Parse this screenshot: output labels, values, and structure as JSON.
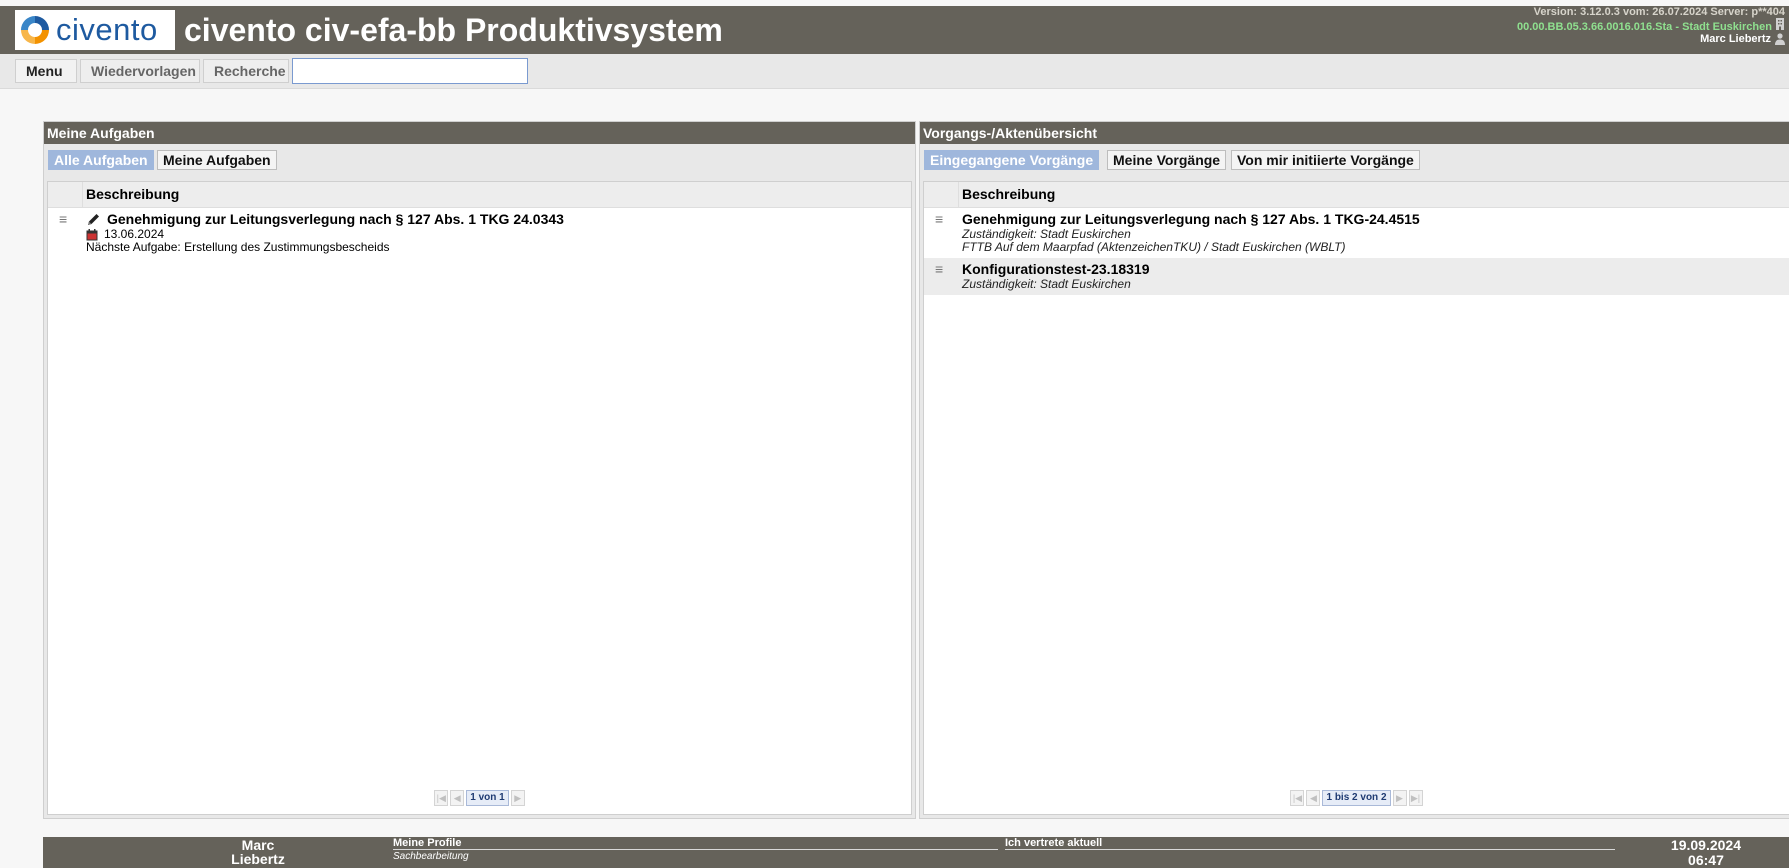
{
  "header": {
    "logo_text": "civento",
    "title": "civento civ-efa-bb Produktivsystem",
    "version": "Version: 3.12.0.3 vom: 26.07.2024 Server: p**404",
    "server": "00.00.BB.05.3.66.0016.016.Sta - Stadt Euskirchen",
    "user": "Marc Liebertz"
  },
  "toolbar": {
    "menu": "Menu",
    "wiedervorlagen": "Wiedervorlagen",
    "recherche": "Recherche",
    "search_value": ""
  },
  "left_panel": {
    "title": "Meine Aufgaben",
    "tabs": [
      "Alle Aufgaben",
      "Meine Aufgaben"
    ],
    "column": "Beschreibung",
    "rows": [
      {
        "title": "Genehmigung zur Leitungsverlegung nach § 127 Abs. 1 TKG 24.0343",
        "date": "13.06.2024",
        "next": "Nächste Aufgabe: Erstellung des Zustimmungsbescheids"
      }
    ],
    "pager": "1 von 1"
  },
  "right_panel": {
    "title": "Vorgangs-/Aktenübersicht",
    "tabs": [
      "Eingegangene Vorgänge",
      "Meine Vorgänge",
      "Von mir initiierte Vorgänge"
    ],
    "column": "Beschreibung",
    "rows": [
      {
        "title": "Genehmigung zur Leitungsverlegung nach § 127 Abs. 1 TKG-24.4515",
        "line1": "Zuständigkeit: Stadt Euskirchen",
        "line2": "FTTB Auf dem Maarpfad (AktenzeichenTKU) / Stadt Euskirchen (WBLT)"
      },
      {
        "title": "Konfigurationstest-23.18319",
        "line1": "Zuständigkeit: Stadt Euskirchen"
      }
    ],
    "pager": "1 bis 2 von 2"
  },
  "footer": {
    "user_first": "Marc",
    "user_last": "Liebertz",
    "profiles_label": "Meine Profile",
    "profile_sub": "Sachbearbeitung",
    "vertrete_label": "Ich vertrete aktuell",
    "date": "19.09.2024",
    "time": "06:47"
  },
  "colors": {
    "header_bg": "#65625a",
    "tab_active": "#9fb7dc",
    "server_text": "#8fe08f",
    "logo_blue": "#1e5aa0",
    "logo_orange": "#f39200"
  }
}
